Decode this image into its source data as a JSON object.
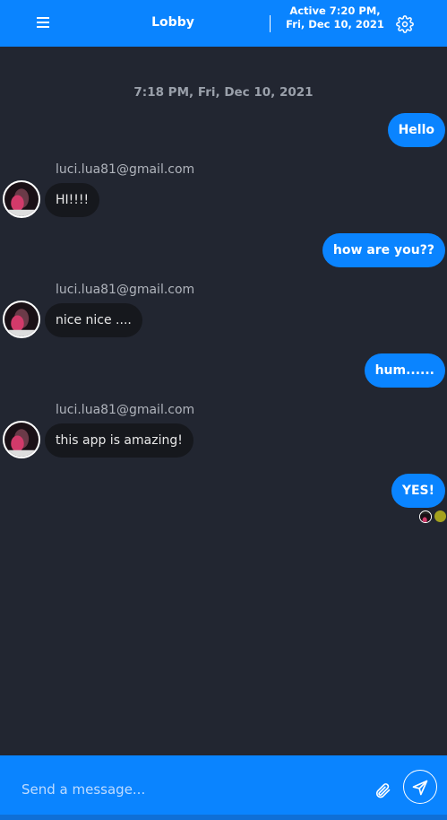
{
  "header": {
    "title": "Lobby",
    "status": "Active 7:20 PM, Fri, Dec 10, 2021"
  },
  "chat": {
    "date_stamp": "7:18 PM, Fri, Dec 10, 2021",
    "messages": [
      {
        "dir": "out",
        "text": "Hello"
      },
      {
        "dir": "in",
        "sender": "luci.lua81@gmail.com",
        "text": "HI!!!!"
      },
      {
        "dir": "out",
        "text": "how are you??"
      },
      {
        "dir": "in",
        "sender": "luci.lua81@gmail.com",
        "text": "nice nice ...."
      },
      {
        "dir": "out",
        "text": "hum......"
      },
      {
        "dir": "in",
        "sender": "luci.lua81@gmail.com",
        "text": "this app is amazing!"
      },
      {
        "dir": "out",
        "text": "YES!"
      }
    ]
  },
  "composer": {
    "placeholder": "Send a message..."
  },
  "colors": {
    "accent": "#0a84ff",
    "background": "#222631",
    "incoming_bubble": "#16181d",
    "read_dot": "#a4a21e"
  },
  "icons": {
    "menu": "hamburger-icon",
    "settings": "gear-icon",
    "attach": "paperclip-icon",
    "send": "paper-plane-icon"
  }
}
